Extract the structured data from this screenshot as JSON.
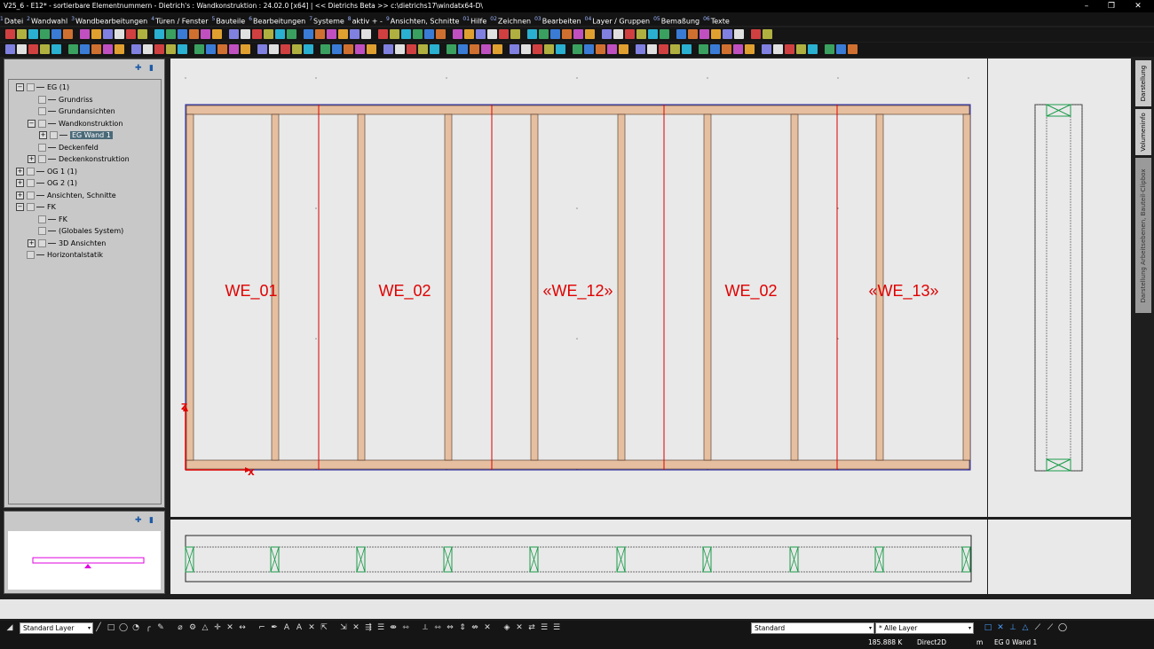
{
  "titlebar": {
    "title": "V25_6 - E12* - sortierbare Elementnummern - Dietrich's : Wandkonstruktion : 24.02.0 [x64] |        << Dietrichs Beta >> c:\\dietrichs17\\windatx64-D\\",
    "minimize": "–",
    "restore": "❐",
    "close": "✕"
  },
  "menu": [
    {
      "key": "1",
      "label": "Datei"
    },
    {
      "key": "2",
      "label": "Wandwahl"
    },
    {
      "key": "3",
      "label": "Wandbearbeitungen"
    },
    {
      "key": "4",
      "label": "Türen / Fenster"
    },
    {
      "key": "5",
      "label": "Bauteile"
    },
    {
      "key": "6",
      "label": "Bearbeitungen"
    },
    {
      "key": "7",
      "label": "Systeme"
    },
    {
      "key": "8",
      "label": "aktiv + -"
    },
    {
      "key": "9",
      "label": "Ansichten, Schnitte"
    },
    {
      "key": "01",
      "label": "Hilfe"
    },
    {
      "key": "02",
      "label": "Zeichnen"
    },
    {
      "key": "03",
      "label": "Bearbeiten"
    },
    {
      "key": "04",
      "label": "Layer / Gruppen"
    },
    {
      "key": "05",
      "label": "Bemaßung"
    },
    {
      "key": "06",
      "label": "Texte"
    }
  ],
  "tree": [
    {
      "indent": 0,
      "expander": "−",
      "label": "EG (1)"
    },
    {
      "indent": 1,
      "expander": "",
      "label": "Grundriss"
    },
    {
      "indent": 1,
      "expander": "",
      "label": "Grundansichten"
    },
    {
      "indent": 1,
      "expander": "−",
      "label": "Wandkonstruktion"
    },
    {
      "indent": 2,
      "expander": "+",
      "label": "EG Wand 1",
      "selected": true
    },
    {
      "indent": 1,
      "expander": "",
      "label": "Deckenfeld"
    },
    {
      "indent": 1,
      "expander": "+",
      "label": "Deckenkonstruktion"
    },
    {
      "indent": 0,
      "expander": "+",
      "label": "OG 1 (1)"
    },
    {
      "indent": 0,
      "expander": "+",
      "label": "OG 2 (1)"
    },
    {
      "indent": 0,
      "expander": "+",
      "label": "Ansichten, Schnitte"
    },
    {
      "indent": 0,
      "expander": "−",
      "label": "FK"
    },
    {
      "indent": 1,
      "expander": "",
      "label": "FK"
    },
    {
      "indent": 1,
      "expander": "",
      "label": "(Globales System)"
    },
    {
      "indent": 1,
      "expander": "+",
      "label": "3D Ansichten"
    },
    {
      "indent": 0,
      "expander": "",
      "label": "Horizontalstatik"
    }
  ],
  "drawing": {
    "elements": [
      "WE_01",
      "WE_02",
      "«WE_12»",
      "WE_02",
      "«WE_13»"
    ],
    "axis_z": "Z",
    "axis_x": "X",
    "colors": {
      "timber": "#e6bfa0",
      "timber_edge": "#4a3020",
      "element_line": "#e00000",
      "outline": "#1a1aa0",
      "axis": "#e00000",
      "label": "#e00000"
    }
  },
  "right_tabs": [
    "Darstellung",
    "Volumeninfo",
    "Darstellung Arbeitsebenen, Bauteil-Clipbox"
  ],
  "bottom_toolbar": {
    "layer_combo": "Standard Layer",
    "style_combo": "Standard",
    "layer_filter_combo": "* Alle Layer"
  },
  "status": {
    "memory": "185.888 K",
    "renderer": "Direct2D",
    "unit": "m",
    "current_element": "EG 0 Wand 1"
  }
}
